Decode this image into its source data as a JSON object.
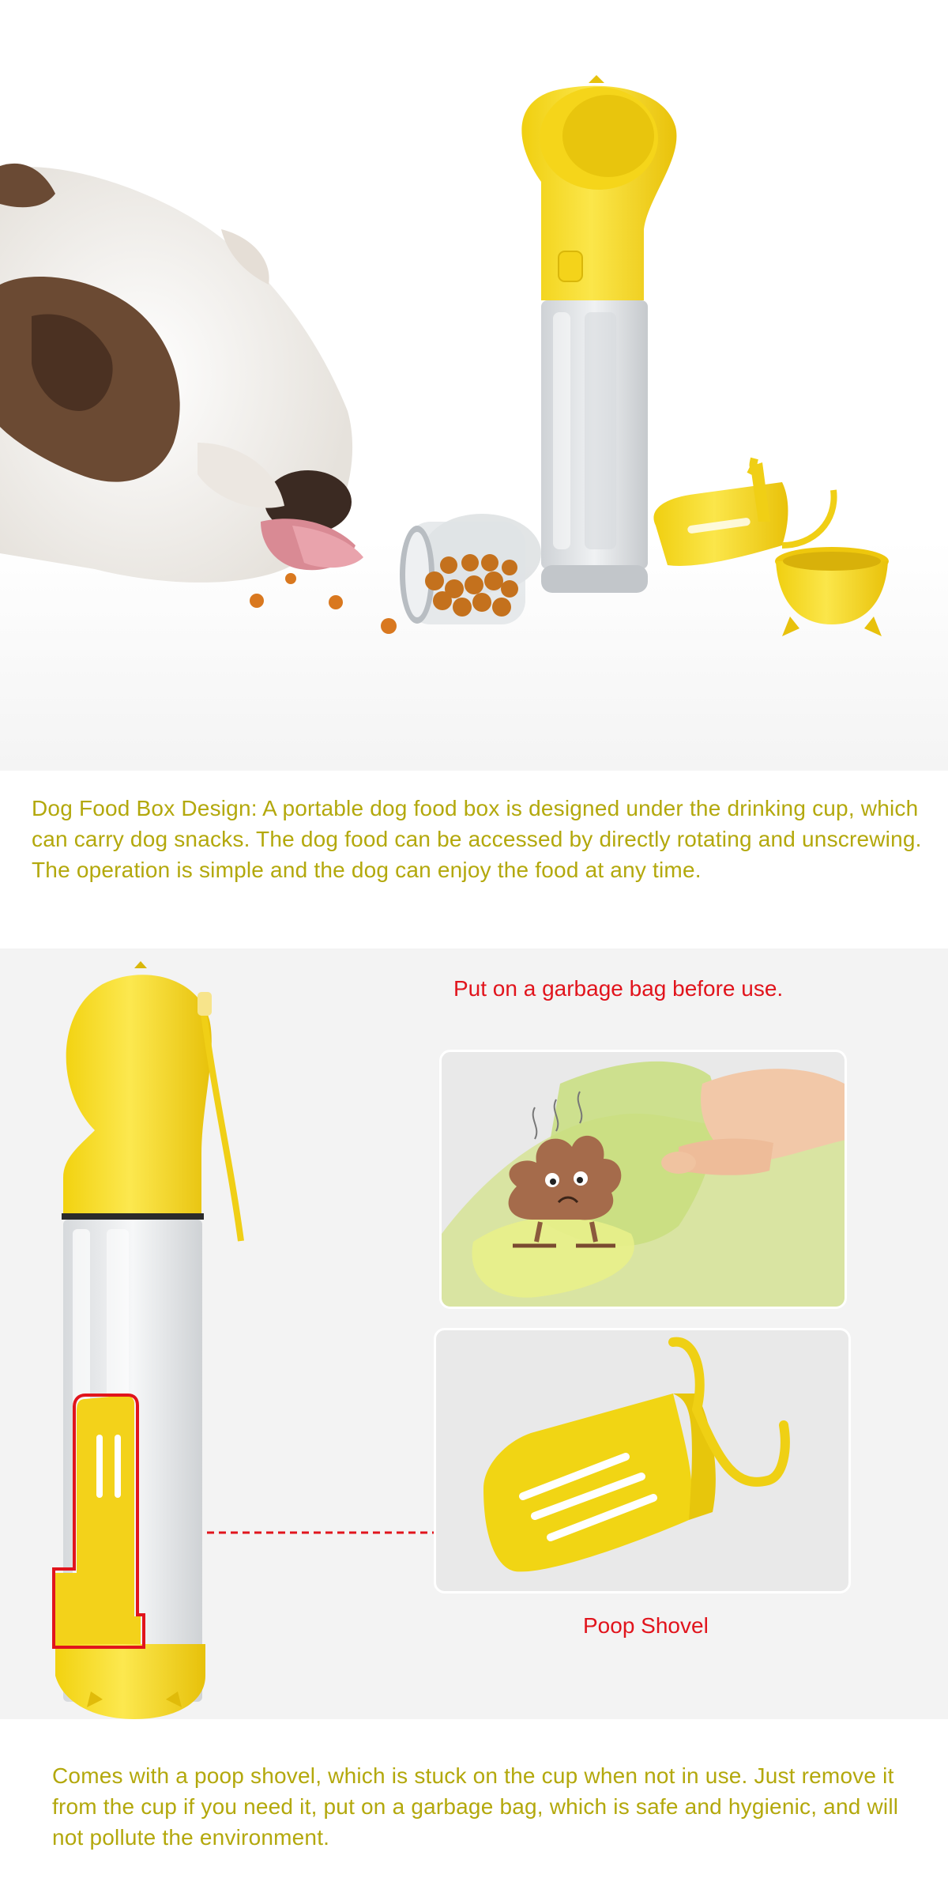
{
  "food_box_section": {
    "description": "Dog Food Box Design: A portable dog food box is designed under the drinking cup, which can carry dog snacks. The dog food can be accessed by directly rotating and unscrewing. The operation is simple and the dog can enjoy the food at any time."
  },
  "poop_shovel_section": {
    "bag_caption": "Put on a garbage bag before use.",
    "shovel_caption": "Poop Shovel",
    "description": "Comes with a poop shovel, which is stuck on the cup when not in use. Just remove it from the cup if you need it, put on a garbage bag, which is safe and hygienic, and will not pollute the environment."
  },
  "colors": {
    "product_yellow": "#f2dc2c",
    "text_olive": "#b3a80c",
    "caption_red": "#e1141c"
  },
  "icons": [
    "bulldog-image",
    "water-bottle-image",
    "food-container-image",
    "poop-shovel-image",
    "food-bowl-image",
    "poop-emoji-icon",
    "garbage-bag-image"
  ]
}
